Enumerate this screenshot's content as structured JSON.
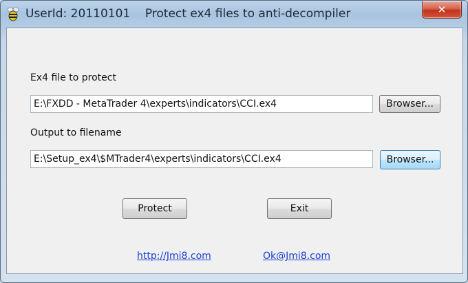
{
  "window": {
    "title": "UserId: 20110101    Protect ex4 files to anti-decompiler",
    "close_glyph": "✕"
  },
  "form": {
    "input_label": "Ex4 file to protect",
    "input_path": "E:\\FXDD - MetaTrader 4\\experts\\indicators\\CCI.ex4",
    "input_browse_label": "Browser...",
    "output_label": "Output to filename",
    "output_path": "E:\\Setup_ex4\\$MTrader4\\experts\\indicators\\CCI.ex4",
    "output_browse_label": "Browser..."
  },
  "actions": {
    "protect_label": "Protect",
    "exit_label": "Exit"
  },
  "links": {
    "website": "http://Jmi8.com",
    "email": "Ok@Jmi8.com"
  },
  "icons": {
    "app": "bee-icon",
    "close": "close-icon"
  }
}
